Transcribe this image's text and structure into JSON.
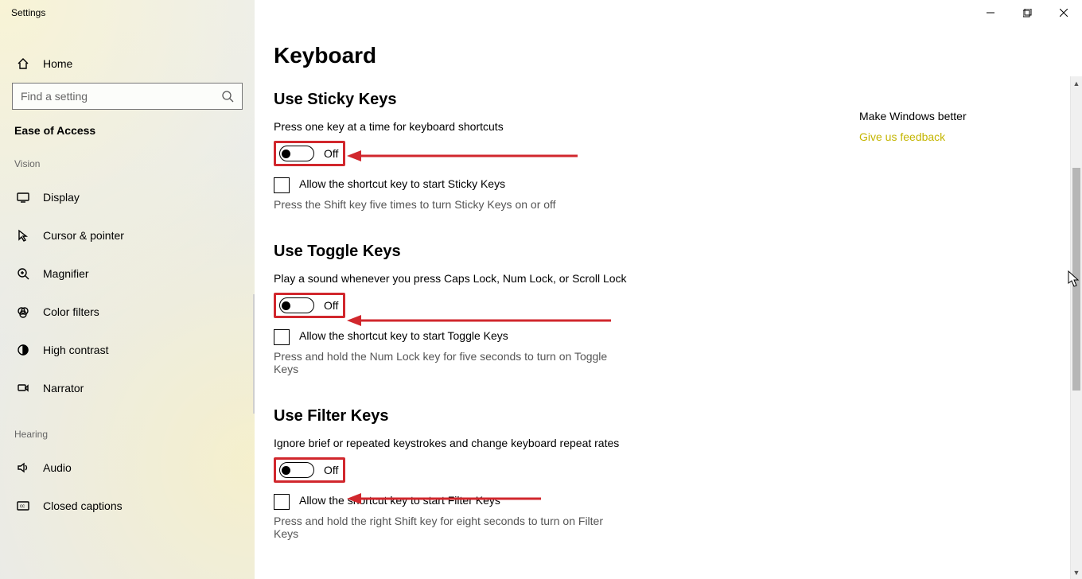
{
  "app_title": "Settings",
  "search": {
    "placeholder": "Find a setting"
  },
  "sidebar": {
    "home": "Home",
    "category": "Ease of Access",
    "groups": [
      {
        "title": "Vision",
        "items": [
          {
            "label": "Display"
          },
          {
            "label": "Cursor & pointer"
          },
          {
            "label": "Magnifier"
          },
          {
            "label": "Color filters"
          },
          {
            "label": "High contrast"
          },
          {
            "label": "Narrator"
          }
        ]
      },
      {
        "title": "Hearing",
        "items": [
          {
            "label": "Audio"
          },
          {
            "label": "Closed captions"
          }
        ]
      }
    ]
  },
  "page": {
    "title": "Keyboard",
    "sections": [
      {
        "heading": "Use Sticky Keys",
        "desc": "Press one key at a time for keyboard shortcuts",
        "toggle": "Off",
        "checkbox_label": "Allow the shortcut key to start Sticky Keys",
        "hint": "Press the Shift key five times to turn Sticky Keys on or off"
      },
      {
        "heading": "Use Toggle Keys",
        "desc": "Play a sound whenever you press Caps Lock, Num Lock, or Scroll Lock",
        "toggle": "Off",
        "checkbox_label": "Allow the shortcut key to start Toggle Keys",
        "hint": "Press and hold the Num Lock key for five seconds to turn on Toggle Keys"
      },
      {
        "heading": "Use Filter Keys",
        "desc": "Ignore brief or repeated keystrokes and change keyboard repeat rates",
        "toggle": "Off",
        "checkbox_label": "Allow the shortcut key to start Filter Keys",
        "hint": "Press and hold the right Shift key for eight seconds to turn on Filter Keys"
      }
    ]
  },
  "right_panel": {
    "heading": "Make Windows better",
    "link": "Give us feedback"
  }
}
